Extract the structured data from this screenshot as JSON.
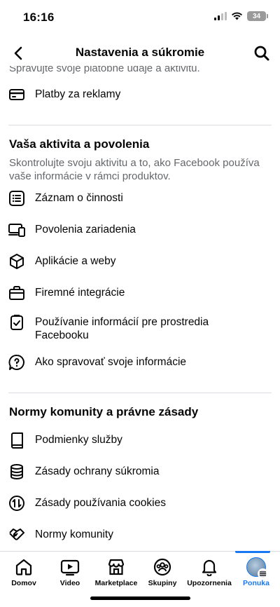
{
  "status_bar": {
    "time": "16:16",
    "battery": "34"
  },
  "header": {
    "title": "Nastavenia a súkromie"
  },
  "cut_text": "Spravujte svoje platobné údaje a aktivitu.",
  "top_items": [
    {
      "label": "Platby za reklamy",
      "icon": "credit-card-icon"
    }
  ],
  "sections": [
    {
      "title": "Vaša aktivita a povolenia",
      "description": "Skontrolujte svoju aktivitu a to, ako Facebook používa vaše informácie v rámci produktov.",
      "items": [
        {
          "label": "Záznam o činnosti",
          "icon": "activity-log-icon"
        },
        {
          "label": "Povolenia zariadenia",
          "icon": "device-icon"
        },
        {
          "label": "Aplikácie a weby",
          "icon": "cube-icon"
        },
        {
          "label": "Firemné integrácie",
          "icon": "briefcase-icon"
        },
        {
          "label": "Používanie informácií pre prostredia Facebooku",
          "icon": "clipboard-icon"
        },
        {
          "label": "Ako spravovať svoje informácie",
          "icon": "question-bubble-icon"
        }
      ]
    },
    {
      "title": "Normy komunity a právne zásady",
      "description": "",
      "items": [
        {
          "label": "Podmienky služby",
          "icon": "book-icon"
        },
        {
          "label": "Zásady ochrany súkromia",
          "icon": "database-icon"
        },
        {
          "label": "Zásady používania cookies",
          "icon": "cookie-arrows-icon"
        },
        {
          "label": "Normy komunity",
          "icon": "handshake-icon"
        }
      ]
    }
  ],
  "bottom_nav": [
    {
      "label": "Domov",
      "icon": "home-icon",
      "active": false
    },
    {
      "label": "Video",
      "icon": "video-icon",
      "active": false
    },
    {
      "label": "Marketplace",
      "icon": "marketplace-icon",
      "active": false
    },
    {
      "label": "Skupiny",
      "icon": "groups-icon",
      "active": false
    },
    {
      "label": "Upozornenia",
      "icon": "bell-icon",
      "active": false
    },
    {
      "label": "Ponuka",
      "icon": "avatar-icon",
      "active": true
    }
  ],
  "colors": {
    "accent": "#1877f2",
    "secondary_text": "#65676b",
    "divider": "#dadde1"
  }
}
